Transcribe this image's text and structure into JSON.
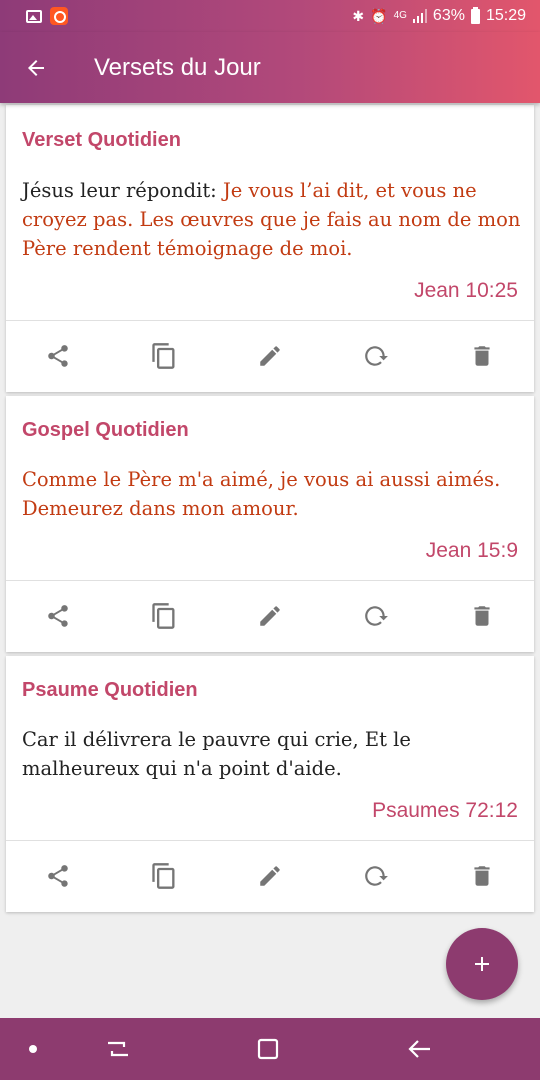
{
  "status_bar": {
    "battery": "63%",
    "time": "15:29",
    "network": "4G"
  },
  "app_bar": {
    "title": "Versets du Jour"
  },
  "cards": [
    {
      "title": "Verset Quotidien",
      "text_plain": "Jésus leur répondit: ",
      "text_highlight": "Je vous l’ai dit, et vous ne croyez pas. Les œuvres que je fais au nom de mon Père rendent témoignage de moi.",
      "reference": "Jean 10:25"
    },
    {
      "title": "Gospel Quotidien",
      "text_highlight": "Comme le Père m'a aimé, je vous ai aussi aimés. Demeurez dans mon amour.",
      "reference": "Jean 15:9"
    },
    {
      "title": "Psaume Quotidien",
      "text_plain": "Car il délivrera le pauvre qui crie, Et le malheureux qui n'a point d'aide.",
      "reference": "Psaumes 72:12"
    }
  ],
  "card_actions": [
    "share-icon",
    "copy-icon",
    "edit-icon",
    "refresh-icon",
    "delete-icon"
  ],
  "colors": {
    "accent": "#c2476a",
    "highlight_text": "#c23b12",
    "primary_dark": "#8d3b6f",
    "icon_gray": "#757575"
  }
}
